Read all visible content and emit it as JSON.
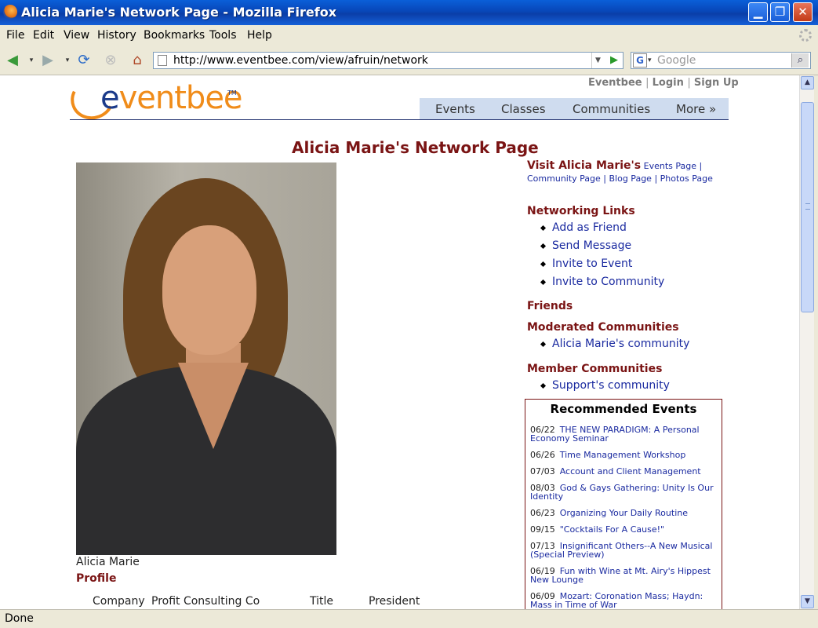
{
  "window": {
    "title": "Alicia Marie's Network Page - Mozilla Firefox"
  },
  "menu": [
    "File",
    "Edit",
    "View",
    "History",
    "Bookmarks",
    "Tools",
    "Help"
  ],
  "address": {
    "url": "http://www.eventbee.com/view/afruin/network"
  },
  "search": {
    "placeholder": "Google"
  },
  "status": {
    "text": "Done"
  },
  "site": {
    "toplinks": [
      "Eventbee",
      "Login",
      "Sign Up"
    ],
    "nav": [
      "Events",
      "Classes",
      "Communities",
      "More »"
    ],
    "logo": {
      "text_left": "e",
      "text_right": "ventbee",
      "tm": "TM"
    }
  },
  "page": {
    "title": "Alicia Marie's Network Page",
    "caption": "Alicia Marie",
    "profile_header": "Profile",
    "profile": {
      "company_label": "Company",
      "company_value": "Profit Consulting Co",
      "title_label": "Title",
      "title_value": "President"
    },
    "visit": {
      "label": "Visit Alicia Marie's",
      "links": [
        "Events Page",
        "Community Page",
        "Blog Page",
        "Photos Page"
      ]
    },
    "networking": {
      "header": "Networking Links",
      "links": [
        "Add as Friend",
        "Send Message",
        "Invite to Event",
        "Invite to Community"
      ]
    },
    "friends_header": "Friends",
    "moderated": {
      "header": "Moderated Communities",
      "items": [
        "Alicia Marie's community"
      ]
    },
    "member": {
      "header": "Member Communities",
      "items": [
        "Support's community"
      ]
    },
    "recommended": {
      "header": "Recommended Events",
      "events": [
        {
          "date": "06/22",
          "title": "THE NEW PARADIGM: A Personal Economy Seminar"
        },
        {
          "date": "06/26",
          "title": "Time Management Workshop"
        },
        {
          "date": "07/03",
          "title": "Account and Client Management"
        },
        {
          "date": "08/03",
          "title": "God & Gays Gathering: Unity Is Our Identity"
        },
        {
          "date": "06/23",
          "title": "Organizing Your Daily Routine"
        },
        {
          "date": "09/15",
          "title": "\"Cocktails For A Cause!\""
        },
        {
          "date": "07/13",
          "title": "Insignificant Others--A New Musical (Special Preview)"
        },
        {
          "date": "06/19",
          "title": "Fun with Wine at Mt. Airy's Hippest New Lounge"
        },
        {
          "date": "06/09",
          "title": "Mozart: Coronation Mass; Haydn: Mass in Time of War"
        }
      ]
    }
  }
}
